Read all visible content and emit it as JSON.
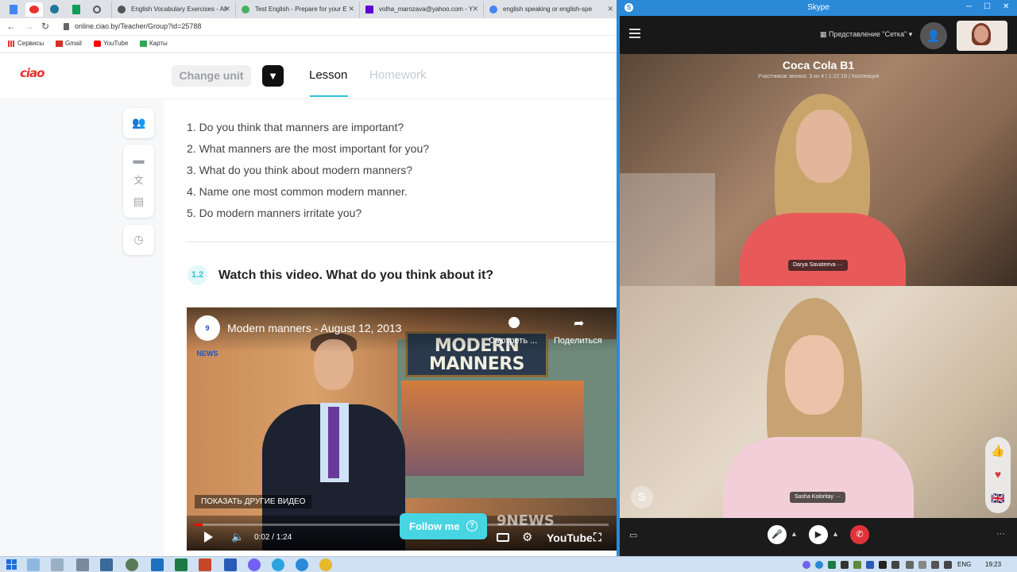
{
  "browser": {
    "tabs": [
      {
        "label": "English Vocabulary Exercises - All",
        "color": "#4caf50"
      },
      {
        "label": "Test English - Prepare for your E",
        "color": "#44b35f"
      },
      {
        "label": "volha_marozava@yahoo.com - Y",
        "color": "#6001d2"
      },
      {
        "label": "english speaking or english-spe",
        "color": "#4285f4"
      }
    ],
    "url": "online.ciao.by/Teacher/Group?id=25788",
    "bookmarks": [
      {
        "label": "Сервисы"
      },
      {
        "label": "Gmail"
      },
      {
        "label": "YouTube"
      },
      {
        "label": "Карты"
      }
    ]
  },
  "site": {
    "logo": "ciao",
    "change_unit": "Change unit",
    "tabs": {
      "lesson": "Lesson",
      "homework": "Homework"
    },
    "accent": "#2ec4d6"
  },
  "lesson": {
    "questions": [
      "1. Do you think that manners are important?",
      "2. What manners are the most important for you?",
      "3. What do you think about modern manners?",
      "4. Name one most common modern manner.",
      "5. Do modern manners irritate you?"
    ],
    "task": {
      "number": "1.2",
      "title": "Watch this video. What do you think about it?"
    }
  },
  "video": {
    "channel": "9 NEWS",
    "title": "Modern manners - August 12, 2013",
    "screen_text": "MODERN MANNERS",
    "watch_later": "Смотреть ...",
    "share": "Поделиться",
    "more_videos": "ПОКАЗАТЬ ДРУГИЕ ВИДЕО",
    "time": "0:02 / 1:24",
    "progress": 0.02,
    "watermark": "9NEWS",
    "youtube": "YouTube"
  },
  "follow_me": "Follow me",
  "skype": {
    "window_title": "Skype",
    "view_label": "Представление \"Сетка\"",
    "call_title": "Coca Cola B1",
    "call_subtitle": "Участников звонка: 3 из 4 | 1:22:18 | Коллекция",
    "participants": [
      {
        "name": "Darya Savateeva"
      },
      {
        "name": "Sasha Koloritay"
      }
    ],
    "brand_color": "#2b8ad8",
    "end_call_color": "#e0343a"
  },
  "taskbar": {
    "lang": "ENG",
    "time": "19:23"
  }
}
